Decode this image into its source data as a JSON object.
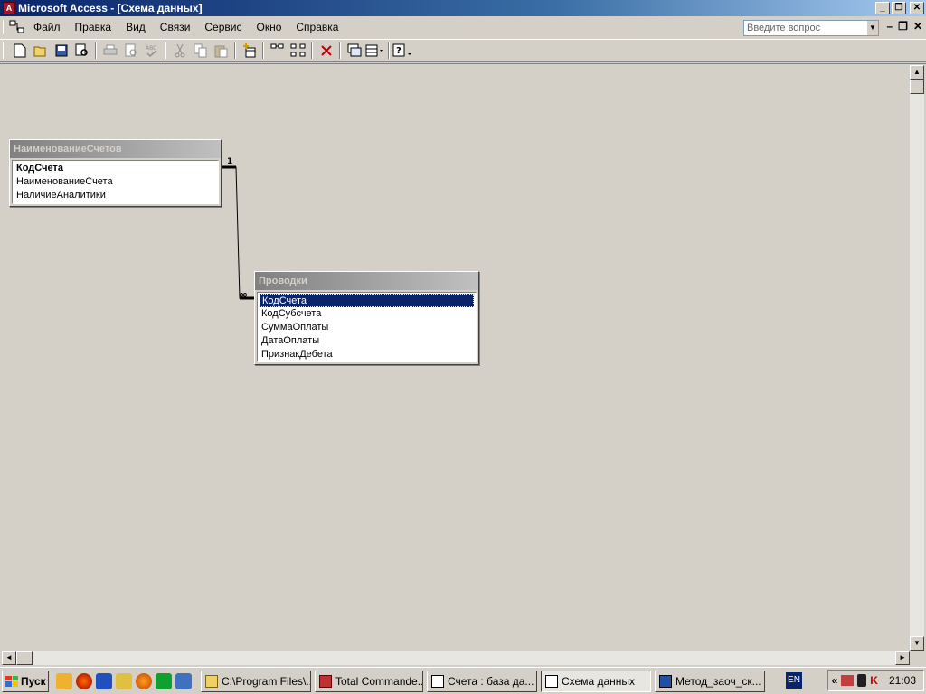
{
  "window": {
    "title": "Microsoft Access - [Схема данных]",
    "app_icon_letter": "A"
  },
  "menu": {
    "items": [
      {
        "label": "Файл"
      },
      {
        "label": "Правка"
      },
      {
        "label": "Вид"
      },
      {
        "label": "Связи"
      },
      {
        "label": "Сервис"
      },
      {
        "label": "Окно"
      },
      {
        "label": "Справка"
      }
    ],
    "ask_placeholder": "Введите вопрос"
  },
  "toolbar": {
    "buttons": [
      "new-icon",
      "open-icon",
      "save-icon",
      "search-icon",
      "print-icon",
      "print-preview-icon",
      "spelling-icon",
      "cut-icon",
      "copy-icon",
      "paste-icon",
      "show-table-icon",
      "show-direct-icon",
      "show-all-icon",
      "delete-icon",
      "new-object-icon",
      "new-object-dropdown-icon",
      "help-icon"
    ]
  },
  "tables": [
    {
      "title": "НаименованиеСчетов",
      "fields": [
        {
          "name": "КодСчета",
          "key": true
        },
        {
          "name": "НаименованиеСчета"
        },
        {
          "name": "НаличиеАналитики"
        }
      ]
    },
    {
      "title": "Проводки",
      "fields": [
        {
          "name": "КодСчета",
          "selected": true
        },
        {
          "name": "КодСубсчета"
        },
        {
          "name": "СуммаОплаты"
        },
        {
          "name": "ДатаОплаты"
        },
        {
          "name": "ПризнакДебета"
        }
      ]
    }
  ],
  "relationship": {
    "one_label": "1",
    "many_label": "∞"
  },
  "taskbar": {
    "start_label": "Пуск",
    "tasks": [
      {
        "label": "C:\\Program Files\\...",
        "icon": "folder-icon"
      },
      {
        "label": "Total Commande...",
        "icon": "total-commander-icon"
      },
      {
        "label": "Счета : база да...",
        "icon": "access-db-icon"
      },
      {
        "label": "Схема данных",
        "icon": "relationships-icon",
        "active": true
      },
      {
        "label": "Метод_заоч_ск...",
        "icon": "word-icon"
      }
    ],
    "language": "EN",
    "clock": "21:03"
  }
}
